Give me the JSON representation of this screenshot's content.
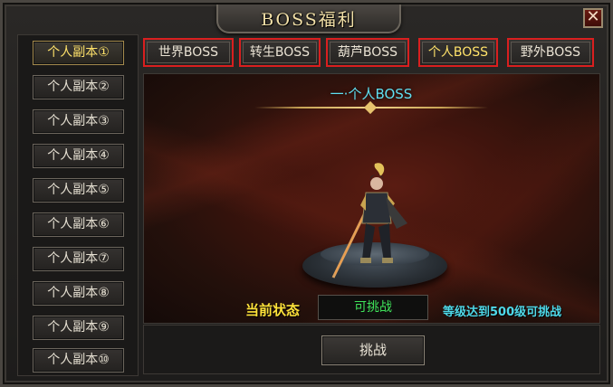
{
  "window": {
    "title": "BOSS福利",
    "close_label": "✕"
  },
  "sidebar": {
    "items": [
      {
        "label": "个人副本①",
        "active": true
      },
      {
        "label": "个人副本②"
      },
      {
        "label": "个人副本③"
      },
      {
        "label": "个人副本④"
      },
      {
        "label": "个人副本⑤"
      },
      {
        "label": "个人副本⑥"
      },
      {
        "label": "个人副本⑦"
      },
      {
        "label": "个人副本⑧"
      },
      {
        "label": "个人副本⑨"
      },
      {
        "label": "个人副本⑩"
      }
    ]
  },
  "tabs": [
    {
      "label": "世界BOSS"
    },
    {
      "label": "转生BOSS"
    },
    {
      "label": "葫芦BOSS"
    },
    {
      "label": "个人BOSS",
      "active": true
    },
    {
      "label": "野外BOSS"
    }
  ],
  "main": {
    "banner": "一·个人BOSS",
    "status_label": "当前状态",
    "status_value": "可挑战",
    "requirement": "等级达到500级可挑战"
  },
  "footer": {
    "challenge_label": "挑战"
  },
  "colors": {
    "tab_highlight": "#d91f1f",
    "active_text": "#ffe26a",
    "status_ok": "#3fe35a",
    "requirement": "#4fd8e8"
  }
}
